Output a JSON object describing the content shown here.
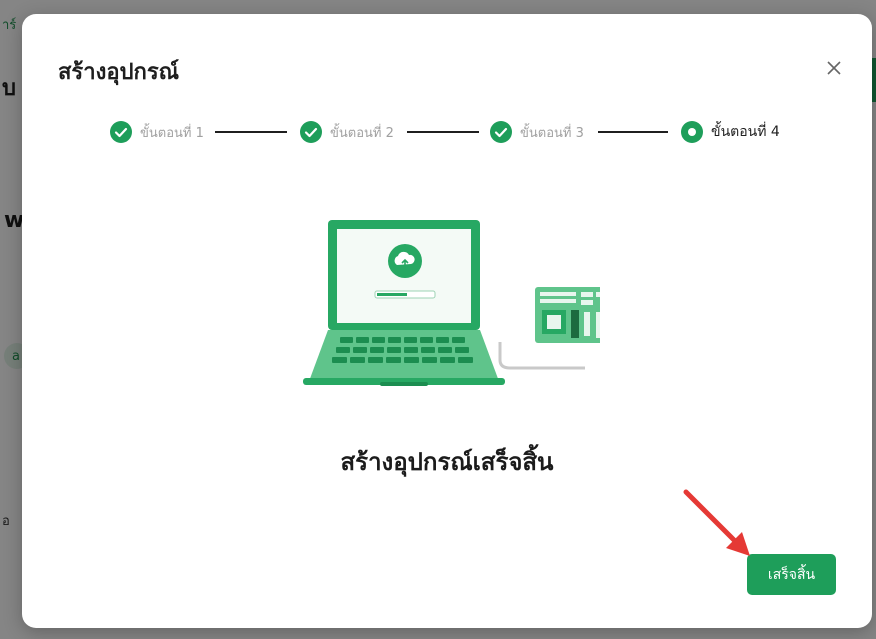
{
  "background": {
    "fragment_top_left": "าร์",
    "fragment_heading_1": "บ",
    "fragment_heading_2": "w",
    "fragment_chip": "a",
    "fragment_bottom": "อ"
  },
  "modal": {
    "title": "สร้างอุปกรณ์",
    "close_icon": "close-icon"
  },
  "stepper": {
    "steps": [
      {
        "label": "ขั้นตอนที่ 1",
        "status": "completed"
      },
      {
        "label": "ขั้นตอนที่ 2",
        "status": "completed"
      },
      {
        "label": "ขั้นตอนที่ 3",
        "status": "completed"
      },
      {
        "label": "ขั้นตอนที่ 4",
        "status": "current"
      }
    ]
  },
  "main": {
    "illustration": "laptop-uploading-to-device",
    "success_message": "สร้างอุปกรณ์เสร็จสิ้น"
  },
  "footer": {
    "finish_label": "เสร็จสิ้น"
  },
  "colors": {
    "primary": "#1e9e5a",
    "annotation_arrow": "#e53935"
  }
}
